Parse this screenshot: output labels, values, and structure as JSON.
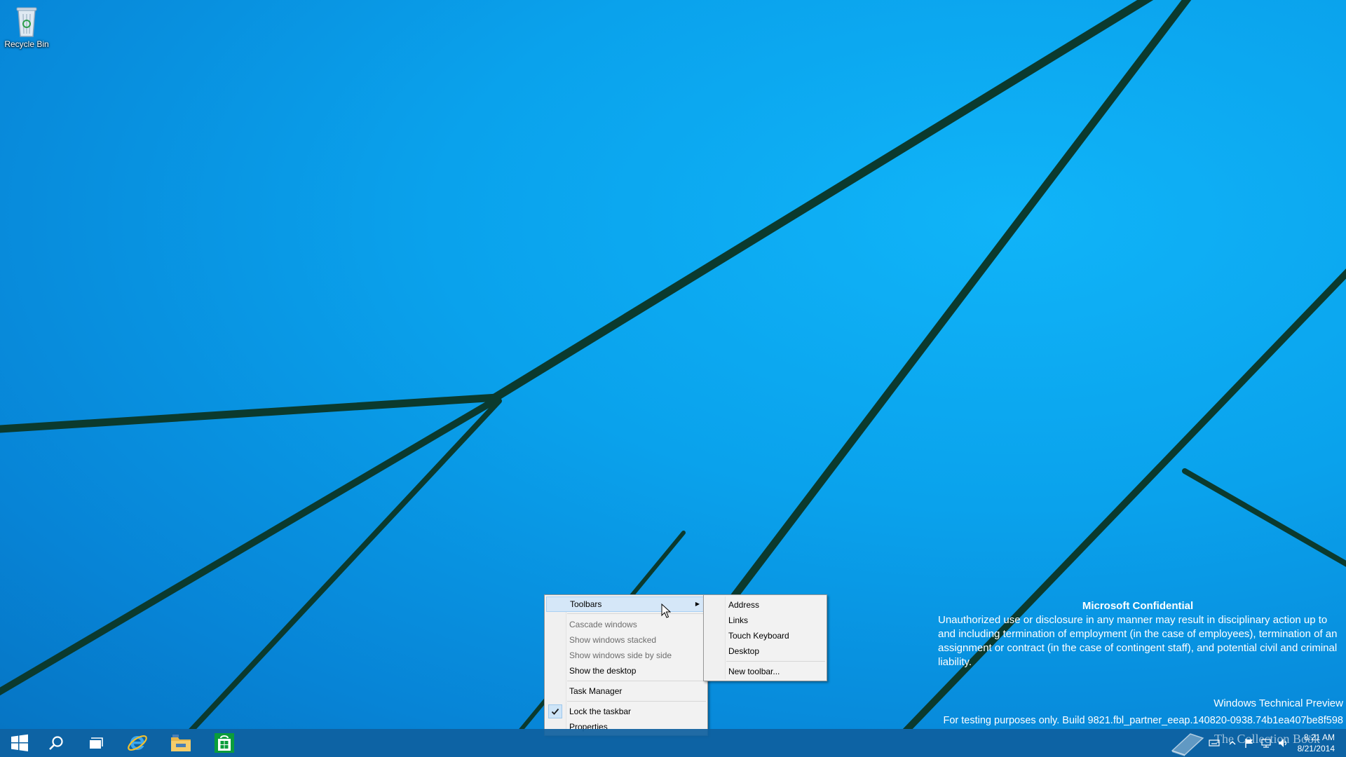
{
  "desktop": {
    "icons": [
      {
        "label": "Recycle Bin",
        "icon": "recycle-bin-icon"
      }
    ]
  },
  "watermark": {
    "confidential_title": "Microsoft Confidential",
    "confidential_text": "Unauthorized use or disclosure in any manner may result in disciplinary action up to and including termination of employment (in the case of employees), termination of an assignment or contract (in the case of contingent staff), and potential civil and criminal liability.",
    "build_title": "Windows Technical Preview",
    "build_line": "For testing purposes only. Build 9821.fbl_partner_eeap.140820-0938.74b1ea407be8f598",
    "overlay_text": "The Collection Book"
  },
  "context_menu": {
    "items": [
      {
        "label": "Toolbars",
        "has_submenu": true,
        "highlighted": true
      },
      {
        "label": "Cascade windows",
        "disabled": true
      },
      {
        "label": "Show windows stacked",
        "disabled": true
      },
      {
        "label": "Show windows side by side",
        "disabled": true
      },
      {
        "label": "Show the desktop"
      },
      {
        "label": "Task Manager"
      },
      {
        "label": "Lock the taskbar",
        "checked": true
      },
      {
        "label": "Properties"
      }
    ]
  },
  "submenu": {
    "items": [
      {
        "label": "Address"
      },
      {
        "label": "Links"
      },
      {
        "label": "Touch Keyboard"
      },
      {
        "label": "Desktop"
      },
      {
        "label": "New toolbar..."
      }
    ]
  },
  "taskbar": {
    "buttons": [
      "start-icon",
      "search-icon",
      "task-view-icon",
      "internet-explorer-icon",
      "file-explorer-icon",
      "store-icon"
    ],
    "clock_time": "8:21 AM",
    "clock_date": "8/21/2014",
    "tray_icons": [
      "keyboard-icon",
      "show-hidden-icon",
      "action-center-flag-icon",
      "network-icon",
      "volume-icon"
    ]
  },
  "colors": {
    "wallpaper": "#0aa2ec",
    "taskbar": "#0e5f9e",
    "menu_highlight": "#d5e7f8"
  }
}
